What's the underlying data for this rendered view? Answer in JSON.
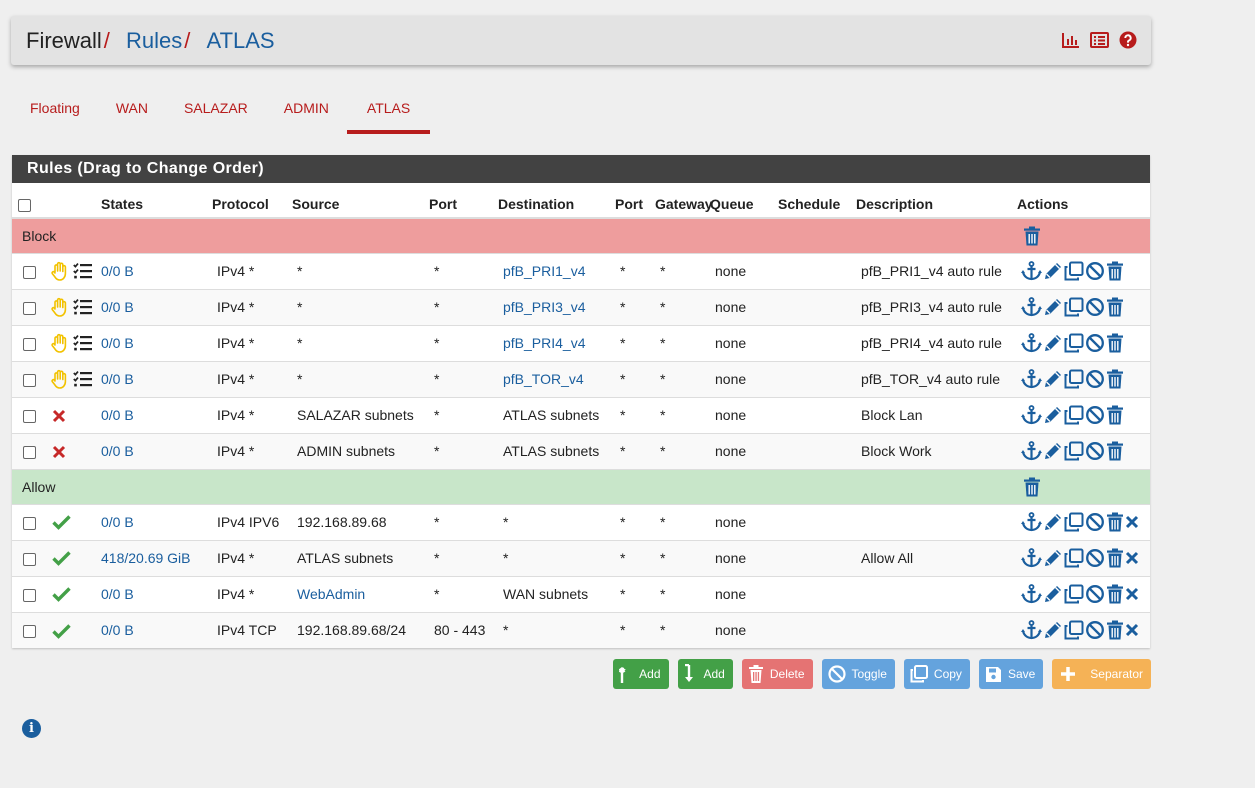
{
  "breadcrumb": {
    "root": "Firewall",
    "sep": "/",
    "level1": "Rules",
    "level2": "ATLAS"
  },
  "header_icons": [
    "chart-icon",
    "list-icon",
    "help-icon"
  ],
  "tabs": [
    {
      "label": "Floating",
      "active": false
    },
    {
      "label": "WAN",
      "active": false
    },
    {
      "label": "SALAZAR",
      "active": false
    },
    {
      "label": "ADMIN",
      "active": false
    },
    {
      "label": "ATLAS",
      "active": true
    }
  ],
  "panel": {
    "title": "Rules (Drag to Change Order)"
  },
  "columns": {
    "states": "States",
    "protocol": "Protocol",
    "source": "Source",
    "port": "Port",
    "destination": "Destination",
    "dport": "Port",
    "gateway": "Gateway",
    "queue": "Queue",
    "schedule": "Schedule",
    "description": "Description",
    "actions": "Actions"
  },
  "sections": {
    "block": "Block",
    "allow": "Allow"
  },
  "rules": [
    {
      "icon": "block-hand",
      "states": "0/0 B",
      "protocol": "IPv4 *",
      "source": "*",
      "source_link": false,
      "port": "*",
      "destination": "pfB_PRI1_v4",
      "dest_link": true,
      "dport": "*",
      "gateway": "*",
      "queue": "none",
      "schedule": "",
      "description": "pfB_PRI1_v4 auto rule",
      "can_delete_x": false
    },
    {
      "icon": "block-hand",
      "states": "0/0 B",
      "protocol": "IPv4 *",
      "source": "*",
      "source_link": false,
      "port": "*",
      "destination": "pfB_PRI3_v4",
      "dest_link": true,
      "dport": "*",
      "gateway": "*",
      "queue": "none",
      "schedule": "",
      "description": "pfB_PRI3_v4 auto rule",
      "can_delete_x": false
    },
    {
      "icon": "block-hand",
      "states": "0/0 B",
      "protocol": "IPv4 *",
      "source": "*",
      "source_link": false,
      "port": "*",
      "destination": "pfB_PRI4_v4",
      "dest_link": true,
      "dport": "*",
      "gateway": "*",
      "queue": "none",
      "schedule": "",
      "description": "pfB_PRI4_v4 auto rule",
      "can_delete_x": false
    },
    {
      "icon": "block-hand",
      "states": "0/0 B",
      "protocol": "IPv4 *",
      "source": "*",
      "source_link": false,
      "port": "*",
      "destination": "pfB_TOR_v4",
      "dest_link": true,
      "dport": "*",
      "gateway": "*",
      "queue": "none",
      "schedule": "",
      "description": "pfB_TOR_v4 auto rule",
      "can_delete_x": false
    },
    {
      "icon": "block-x",
      "states": "0/0 B",
      "protocol": "IPv4 *",
      "source": "SALAZAR subnets",
      "source_link": false,
      "port": "*",
      "destination": "ATLAS subnets",
      "dest_link": false,
      "dport": "*",
      "gateway": "*",
      "queue": "none",
      "schedule": "",
      "description": "Block Lan",
      "can_delete_x": false
    },
    {
      "icon": "block-x",
      "states": "0/0 B",
      "protocol": "IPv4 *",
      "source": "ADMIN subnets",
      "source_link": false,
      "port": "*",
      "destination": "ATLAS subnets",
      "dest_link": false,
      "dport": "*",
      "gateway": "*",
      "queue": "none",
      "schedule": "",
      "description": "Block Work",
      "can_delete_x": false
    },
    {
      "icon": "pass-check",
      "states": "0/0 B",
      "protocol": "IPv4 IPV6",
      "source": "192.168.89.68",
      "source_link": false,
      "port": "*",
      "destination": "*",
      "dest_link": false,
      "dport": "*",
      "gateway": "*",
      "queue": "none",
      "schedule": "",
      "description": "",
      "can_delete_x": true
    },
    {
      "icon": "pass-check",
      "states": "418/20.69 GiB",
      "protocol": "IPv4 *",
      "source": "ATLAS subnets",
      "source_link": false,
      "port": "*",
      "destination": "*",
      "dest_link": false,
      "dport": "*",
      "gateway": "*",
      "queue": "none",
      "schedule": "",
      "description": "Allow All",
      "can_delete_x": true
    },
    {
      "icon": "pass-check",
      "states": "0/0 B",
      "protocol": "IPv4 *",
      "source": "WebAdmin",
      "source_link": true,
      "port": "*",
      "destination": "WAN subnets",
      "dest_link": false,
      "dport": "*",
      "gateway": "*",
      "queue": "none",
      "schedule": "",
      "description": "",
      "can_delete_x": true
    },
    {
      "icon": "pass-check",
      "states": "0/0 B",
      "protocol": "IPv4 TCP",
      "source": "192.168.89.68/24",
      "source_link": false,
      "port": "80 - 443",
      "destination": "*",
      "dest_link": false,
      "dport": "*",
      "gateway": "*",
      "queue": "none",
      "schedule": "",
      "description": "",
      "can_delete_x": true
    }
  ],
  "buttons": {
    "add_top": "Add",
    "add_bottom": "Add",
    "delete": "Delete",
    "toggle": "Toggle",
    "copy": "Copy",
    "save": "Save",
    "separator": "Separator"
  },
  "info_glyph": "i",
  "colors": {
    "accent_red": "#b71c1c",
    "link_blue": "#1a5e9e",
    "block_section": "#ee9d9d",
    "allow_section": "#c8e6c9",
    "pass_green": "#43a047",
    "hand_yellow": "#f2c200"
  }
}
